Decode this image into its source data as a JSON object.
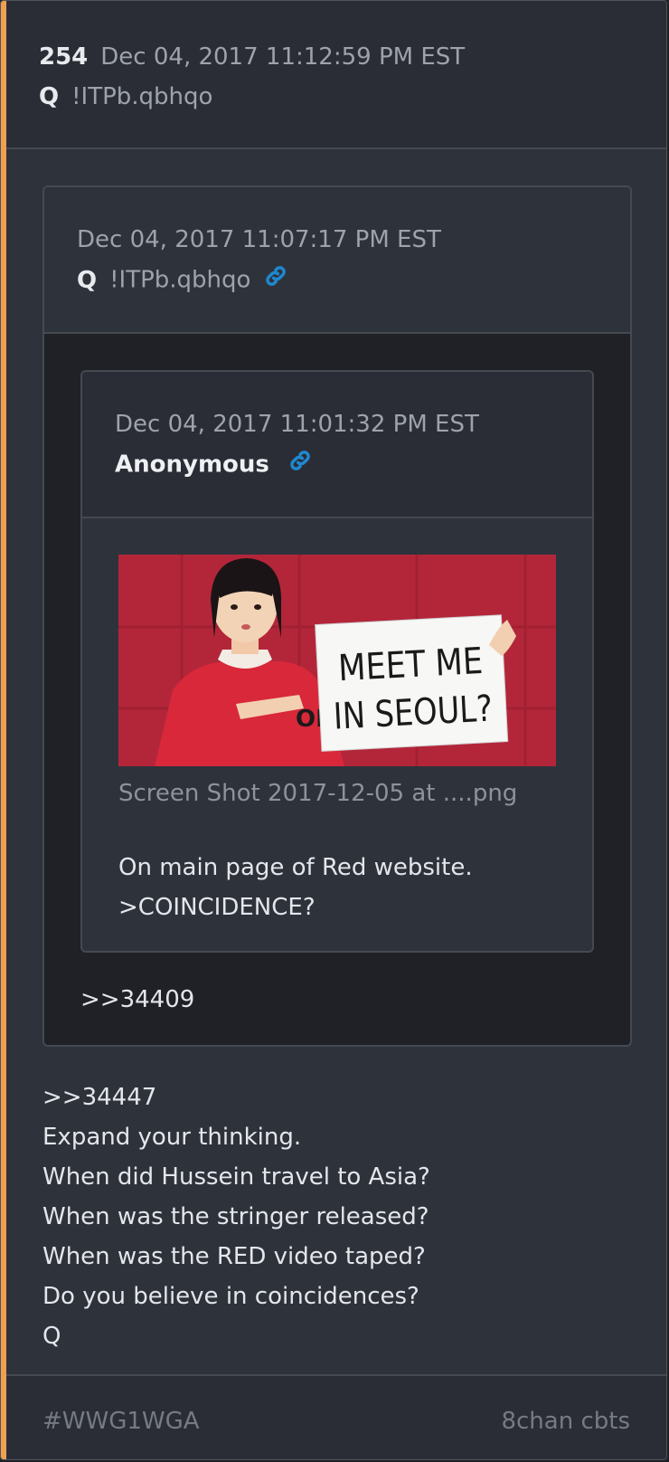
{
  "post": {
    "number": "254",
    "date": "Dec 04, 2017 11:12:59 PM EST",
    "author": "Q",
    "tripcode": "!ITPb.qbhqo",
    "accent_color": "#f0a050"
  },
  "quote1": {
    "date": "Dec 04, 2017 11:07:17 PM EST",
    "author": "Q",
    "tripcode": "!ITPb.qbhqo",
    "icon": "link-icon",
    "reply_ref": ">>34409"
  },
  "quote2": {
    "date": "Dec 04, 2017 11:01:32 PM EST",
    "author": "Anonymous",
    "icon": "link-icon",
    "image": {
      "sign_line1": "MEET ME",
      "sign_line2": "IN SEOUL?",
      "shirt_text": "OI"
    },
    "filename": "Screen Shot 2017-12-05 at ....png",
    "text_lines": [
      "On main page of Red website.",
      ">COINCIDENCE?"
    ]
  },
  "body_lines": [
    ">>34447",
    "Expand your thinking.",
    "When did Hussein travel to Asia?",
    "When was the stringer released?",
    "When was the RED video taped?",
    "Do you believe in coincidences?",
    "Q"
  ],
  "footer": {
    "hashtag": "#WWG1WGA",
    "source": "8chan cbts"
  },
  "colors": {
    "link_blue": "#1e88d0",
    "image_red": "#b3263a"
  }
}
